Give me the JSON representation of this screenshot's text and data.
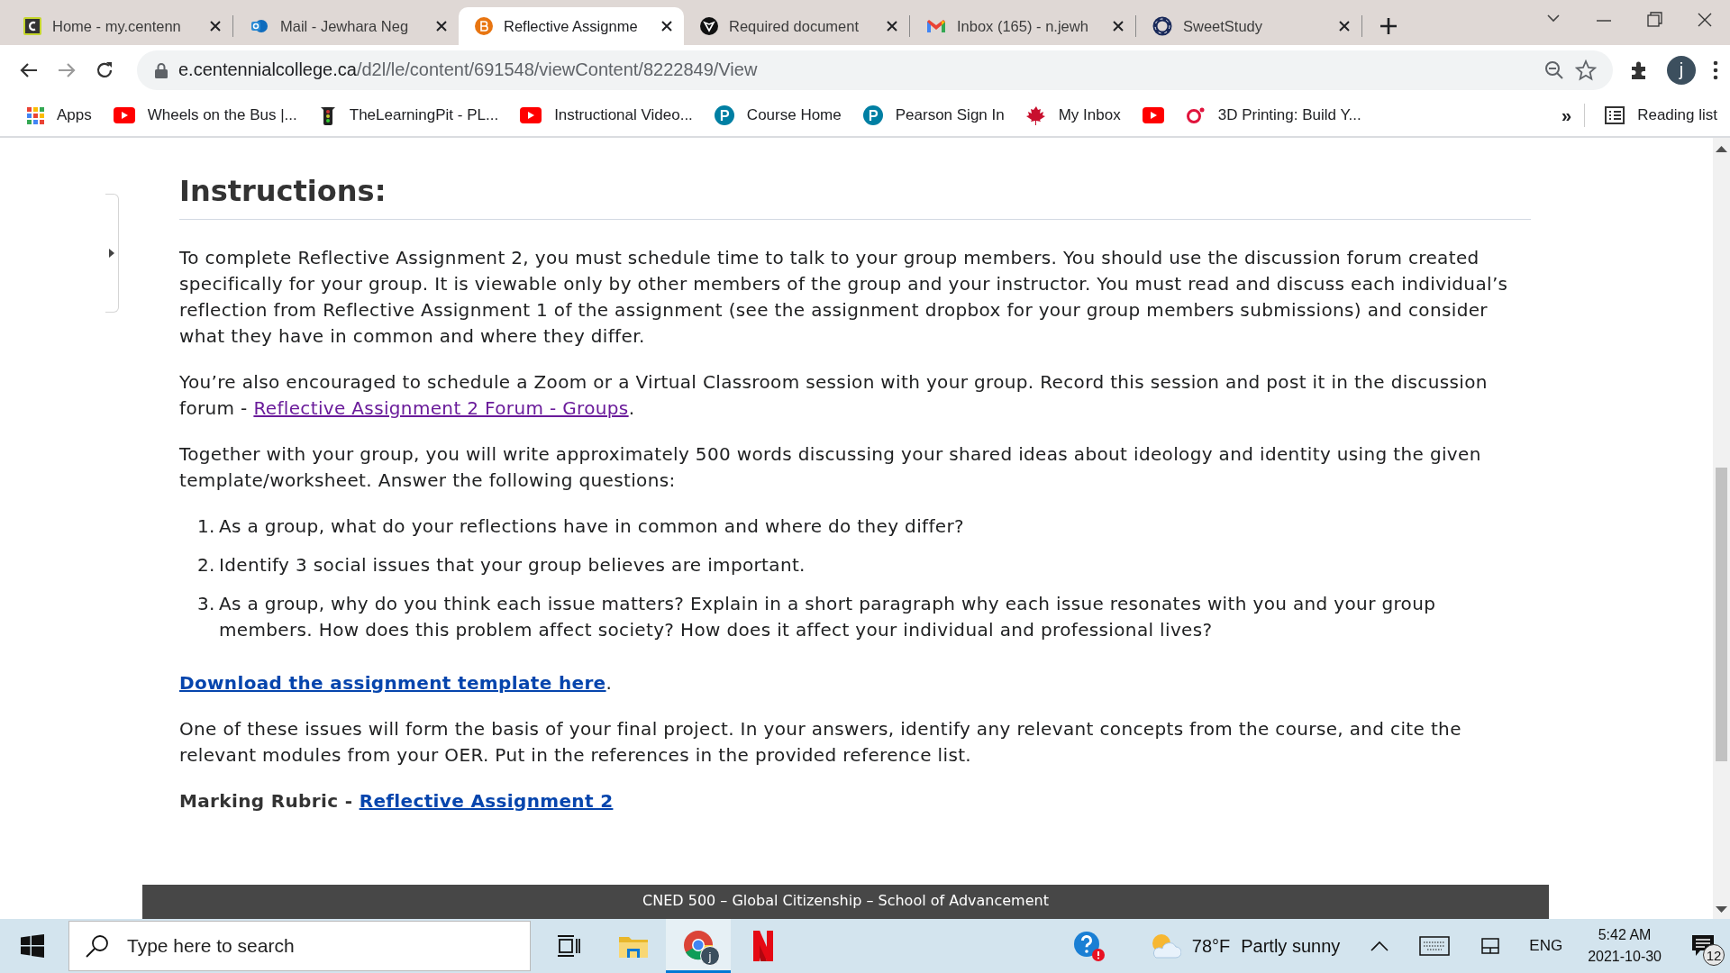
{
  "tabs": [
    {
      "title": "Home - my.centenn",
      "kind": "c-logo",
      "selected": false
    },
    {
      "title": "Mail - Jewhara Neg",
      "kind": "mail",
      "selected": false
    },
    {
      "title": "Reflective Assignme",
      "kind": "b-logo",
      "selected": true
    },
    {
      "title": "Required document",
      "kind": "shield",
      "selected": false
    },
    {
      "title": "Inbox (165) - n.jewh",
      "kind": "gmail",
      "selected": false
    },
    {
      "title": "SweetStudy",
      "kind": "ring",
      "selected": false
    }
  ],
  "toolbar": {
    "host": "e.centennialcollege.ca",
    "path": "/d2l/le/content/691548/viewContent/8222849/View",
    "profile_initial": "j"
  },
  "bookmarks": {
    "items": [
      {
        "label": "Apps",
        "kind": "apps"
      },
      {
        "label": "Wheels on the Bus |...",
        "kind": "youtube"
      },
      {
        "label": "TheLearningPit - PL...",
        "kind": "traffic-light"
      },
      {
        "label": "Instructional Video...",
        "kind": "youtube"
      },
      {
        "label": "Course Home",
        "kind": "pearson"
      },
      {
        "label": "Pearson Sign In",
        "kind": "pearson"
      },
      {
        "label": "My Inbox",
        "kind": "maple-leaf"
      },
      {
        "kind": "youtube"
      },
      {
        "label": "3D Printing: Build Y...",
        "kind": "red-ring"
      }
    ],
    "overflow": "»",
    "reading_list": "Reading list"
  },
  "content": {
    "heading": "Instructions:",
    "blocks": [
      {
        "kind": "paragraph",
        "parts": [
          {
            "text": "To complete Reflective Assignment 2, you must schedule time to talk to your group members. You should use the discussion forum created specifically for your group. It is viewable only by other members of the group and your instructor. You must read and discuss each individual’s reflection from Reflective Assignment 1 of the assignment (see the assignment dropbox for your group members submissions) and consider what they have in common and where they differ."
          }
        ]
      },
      {
        "kind": "paragraph",
        "parts": [
          {
            "text": "You’re also encouraged to schedule a Zoom or a Virtual Classroom session with your group. Record this session and post it in the discussion forum - "
          },
          {
            "link": "Reflective Assignment 2 Forum - Groups",
            "visited": true
          },
          {
            "text": "."
          }
        ]
      },
      {
        "kind": "paragraph",
        "parts": [
          {
            "text": "Together with your group, you will write approximately 500 words discussing your shared ideas about ideology and identity using the given template/worksheet. Answer the following questions:"
          }
        ]
      },
      {
        "kind": "list",
        "items": [
          {
            "number": "1.",
            "text": "As a group, what do your reflections have in common and where do they differ?"
          },
          {
            "number": "2.",
            "text": "Identify 3 social issues that your group believes are important."
          },
          {
            "number": "3.",
            "text": "As a group, why do you think each issue matters? Explain in a short paragraph why each issue resonates with you and your group members. How does this problem affect society? How does it affect your individual and professional lives?"
          }
        ]
      },
      {
        "kind": "paragraph",
        "parts": [
          {
            "link": "Download the assignment template here",
            "visited": false,
            "bold": true
          },
          {
            "text": "."
          }
        ]
      },
      {
        "kind": "paragraph",
        "parts": [
          {
            "text": "One of these issues will form the basis of your final project. In your answers, identify any relevant concepts from the course, and cite the relevant modules from your OER. Put in the references in the provided reference list."
          }
        ]
      },
      {
        "kind": "paragraph",
        "parts": [
          {
            "text": "Marking Rubric - ",
            "bold": true
          },
          {
            "link": "Reflective Assignment 2",
            "visited": false,
            "bold": true
          }
        ]
      }
    ],
    "footer": "CNED 500 – Global Citizenship – School of Advancement"
  },
  "taskbar": {
    "search": {
      "placeholder": "Type here to search"
    },
    "profile_initial": "j",
    "temperature": "78°F",
    "weather": "Partly sunny",
    "language": "ENG",
    "time": "5:42 AM",
    "date": "2021-10-30",
    "notifications": "12"
  }
}
